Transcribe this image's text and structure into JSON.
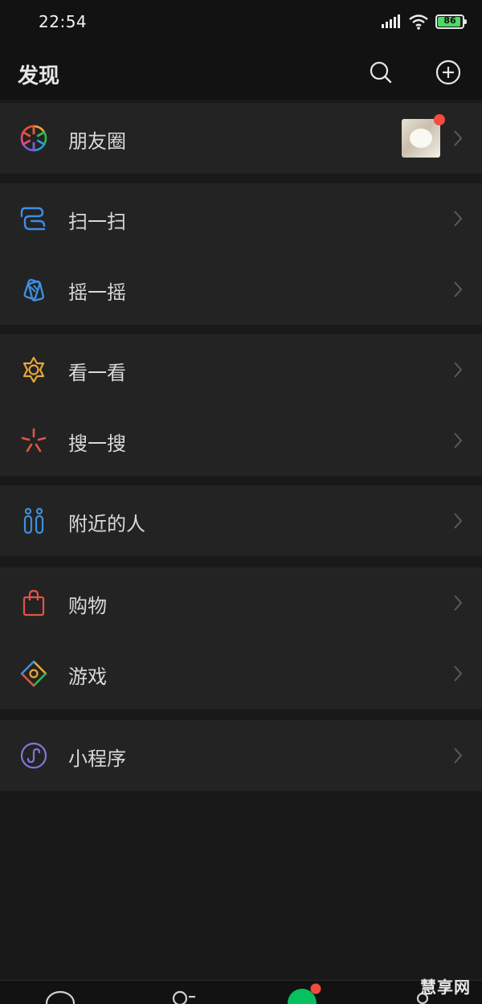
{
  "status_bar": {
    "time": "22:54",
    "battery": "86"
  },
  "header": {
    "title": "发现"
  },
  "items": [
    {
      "label": "朋友圈"
    },
    {
      "label": "扫一扫"
    },
    {
      "label": "摇一摇"
    },
    {
      "label": "看一看"
    },
    {
      "label": "搜一搜"
    },
    {
      "label": "附近的人"
    },
    {
      "label": "购物"
    },
    {
      "label": "游戏"
    },
    {
      "label": "小程序"
    }
  ],
  "colors": {
    "background": "#191919",
    "row_background": "#232323",
    "scan": "#3d8fe0",
    "look": "#e7a933",
    "search": "#e05545",
    "nearby": "#3d8fe0",
    "shop": "#e05545",
    "miniprogram": "#7f78d8",
    "accent": "#07c160",
    "badge": "#f24b3f"
  },
  "icons": [
    "moments-icon",
    "scan-icon",
    "shake-icon",
    "look-icon",
    "search-feature-icon",
    "people-nearby-icon",
    "shopping-bag-icon",
    "games-icon",
    "mini-program-icon"
  ],
  "watermark": "慧享网"
}
